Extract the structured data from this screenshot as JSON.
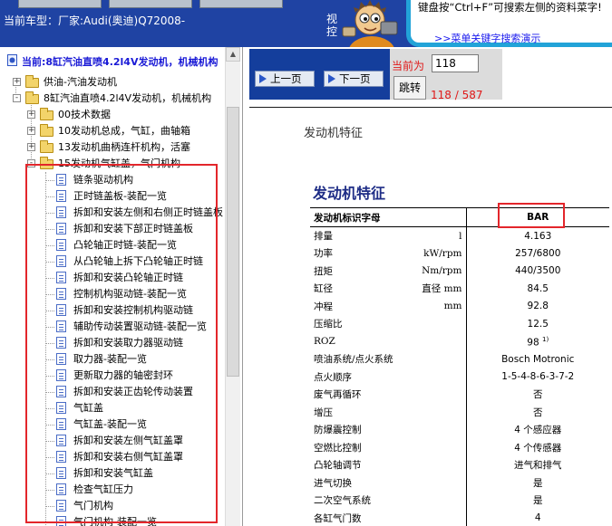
{
  "header": {
    "car_model_prefix": "当前车型：",
    "car_model": "厂家:Audi(奥迪)Q72008-",
    "view_partial": "视控",
    "hint_text": "键盘按“Ctrl+F”可搜索左侧的资料菜字!",
    "hint_link": ">>菜单关键字搜索演示"
  },
  "tree": {
    "current": "当前:8缸汽油直喷4.2l4V发动机，机械机构",
    "nodes": [
      {
        "label": "供油-汽油发动机",
        "type": "folder",
        "level": 1,
        "expander": "+"
      },
      {
        "label": "8缸汽油直喷4.2l4V发动机，机械机构",
        "type": "folder",
        "level": 1,
        "expander": "-"
      },
      {
        "label": "00技术数据",
        "type": "folder",
        "level": 2,
        "expander": "+"
      },
      {
        "label": "10发动机总成，气缸，曲轴箱",
        "type": "folder",
        "level": 2,
        "expander": "+"
      },
      {
        "label": "13发动机曲柄连杆机构，活塞",
        "type": "folder",
        "level": 2,
        "expander": "+"
      },
      {
        "label": "15发动机气缸盖，气门机构",
        "type": "folder",
        "level": 2,
        "expander": "-"
      }
    ],
    "items": [
      "链条驱动机构",
      "正时链盖板-装配一览",
      "拆卸和安装左侧和右侧正时链盖板",
      "拆卸和安装下部正时链盖板",
      "凸轮轴正时链-装配一览",
      "从凸轮轴上拆下凸轮轴正时链",
      "拆卸和安装凸轮轴正时链",
      "控制机构驱动链-装配一览",
      "拆卸和安装控制机构驱动链",
      "辅助传动装置驱动链-装配一览",
      "拆卸和安装取力器驱动链",
      "取力器-装配一览",
      "更新取力器的轴密封环",
      "拆卸和安装正齿轮传动装置",
      "气缸盖",
      "气缸盖-装配一览",
      "拆卸和安装左侧气缸盖罩",
      "拆卸和安装右侧气缸盖罩",
      "拆卸和安装气缸盖",
      "检查气缸压力",
      "气门机构",
      "气门机构-装配一览"
    ]
  },
  "nav": {
    "prev_label": "上一页",
    "next_label": "下一页",
    "page_label": "当前为",
    "page_value": "118",
    "go_label": "跳转",
    "page_count": "118 / 587"
  },
  "doc": {
    "header": "发动机特征",
    "title": "发动机特征",
    "table_head": {
      "key": "发动机标识字母",
      "value": "BAR"
    },
    "rows": [
      {
        "k": "排量",
        "u": "l",
        "v": "4.163"
      },
      {
        "k": "功率",
        "u": "kW/rpm",
        "v": "257/6800"
      },
      {
        "k": "扭矩",
        "u": "Nm/rpm",
        "v": "440/3500"
      },
      {
        "k": "缸径",
        "u": "直径 mm",
        "v": "84.5"
      },
      {
        "k": "冲程",
        "u": "mm",
        "v": "92.8"
      },
      {
        "k": "压缩比",
        "u": "",
        "v": "12.5"
      },
      {
        "k": "ROZ",
        "u": "",
        "v": "98",
        "sup": "1)"
      },
      {
        "k": "喷油系统/点火系统",
        "u": "",
        "v": "Bosch Motronic"
      },
      {
        "k": "点火顺序",
        "u": "",
        "v": "1-5-4-8-6-3-7-2"
      },
      {
        "k": "废气再循环",
        "u": "",
        "v": "否"
      },
      {
        "k": "增压",
        "u": "",
        "v": "否"
      },
      {
        "k": "防爆震控制",
        "u": "",
        "v": "4 个感应器"
      },
      {
        "k": "空燃比控制",
        "u": "",
        "v": "4 个传感器"
      },
      {
        "k": "凸轮轴调节",
        "u": "",
        "v": "进气和排气"
      },
      {
        "k": "进气切换",
        "u": "",
        "v": "是"
      },
      {
        "k": "二次空气系统",
        "u": "",
        "v": "是"
      },
      {
        "k": "各缸气门数",
        "u": "",
        "v": "4"
      }
    ]
  },
  "colors": {
    "header_bg": "#1f43a3",
    "highlight": "#e3262b",
    "tree_current": "#1a1ad6",
    "hint_border": "#22a3d8",
    "doc_title": "#1e2d86",
    "page_text": "#e01818"
  }
}
